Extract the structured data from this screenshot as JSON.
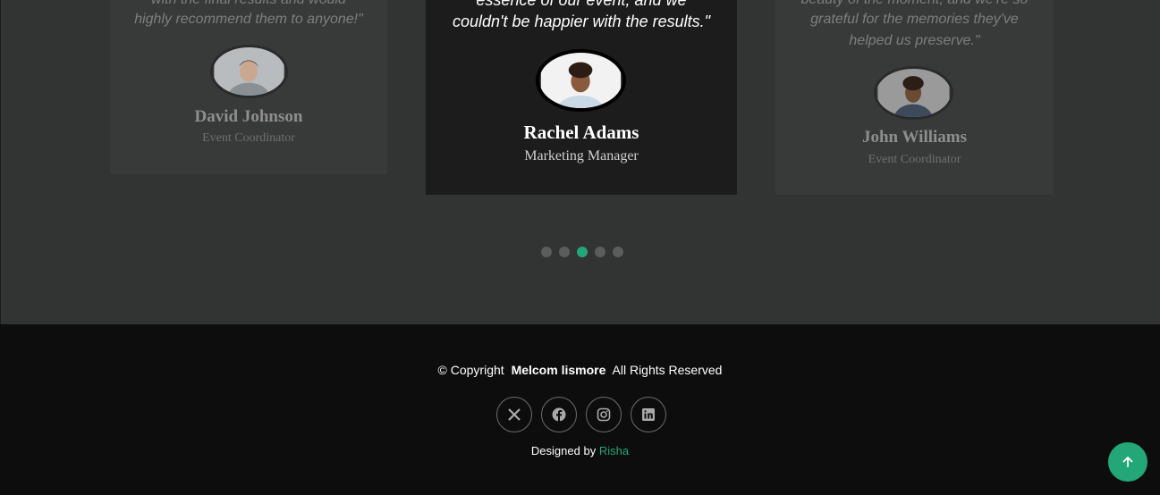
{
  "testimonials": [
    {
      "quote_lines": [
        "with the final results and would",
        "highly recommend them to anyone!\""
      ],
      "name": "David Johnson",
      "role": "Event Coordinator"
    },
    {
      "quote_lines": [
        "essence of our event, and we",
        "couldn't be happier with the results.\""
      ],
      "name": "Rachel Adams",
      "role": "Marketing Manager"
    },
    {
      "quote_lines": [
        "beauty of the moment, and we're so",
        "grateful for the memories they've",
        "helped us preserve.\""
      ],
      "name": "John Williams",
      "role": "Event Coordinator"
    }
  ],
  "carousel": {
    "count": 5,
    "active_index": 2
  },
  "footer": {
    "copyright_prefix": "© Copyright",
    "brand": "Melcom lismore",
    "copyright_suffix": "All Rights Reserved",
    "social_icons": [
      "x-icon",
      "facebook-icon",
      "instagram-icon",
      "linkedin-icon"
    ],
    "designed_by_label": "Designed by",
    "designer": "Risha"
  },
  "colors": {
    "accent": "#23a776",
    "footer_bg": "#0d0d0d",
    "section_bg": "#323333"
  }
}
